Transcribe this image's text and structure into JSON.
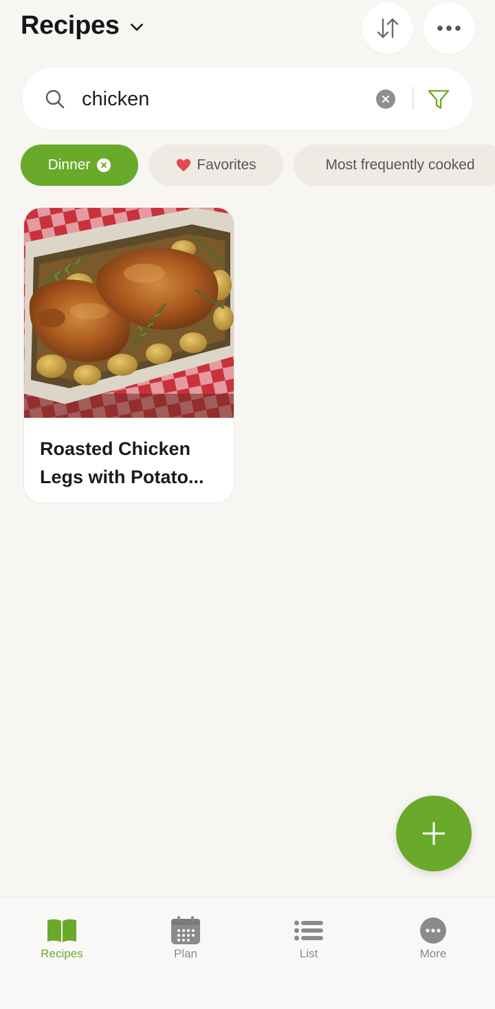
{
  "header": {
    "title": "Recipes",
    "icons": [
      "chevron-down-icon",
      "sort-icon",
      "more-icon"
    ]
  },
  "search": {
    "value": "chicken",
    "placeholder": "Search recipes"
  },
  "chips": [
    {
      "label": "Dinner",
      "active": true,
      "icon": "close-icon"
    },
    {
      "label": "Favorites",
      "active": false,
      "icon": "heart-icon"
    },
    {
      "label": "Most frequently cooked",
      "active": false
    }
  ],
  "recipes": [
    {
      "title": "Roasted Chicken Legs with Potato..."
    }
  ],
  "fab": {
    "icon": "plus-icon"
  },
  "nav": [
    {
      "label": "Recipes",
      "icon": "book-icon",
      "active": true
    },
    {
      "label": "Plan",
      "icon": "calendar-icon",
      "active": false
    },
    {
      "label": "List",
      "icon": "list-icon",
      "active": false
    },
    {
      "label": "More",
      "icon": "more-circle-icon",
      "active": false
    }
  ],
  "colors": {
    "accent": "#6aaa2b",
    "background": "#f7f6f3",
    "chip": "#efebe4",
    "heart": "#e5484d"
  }
}
